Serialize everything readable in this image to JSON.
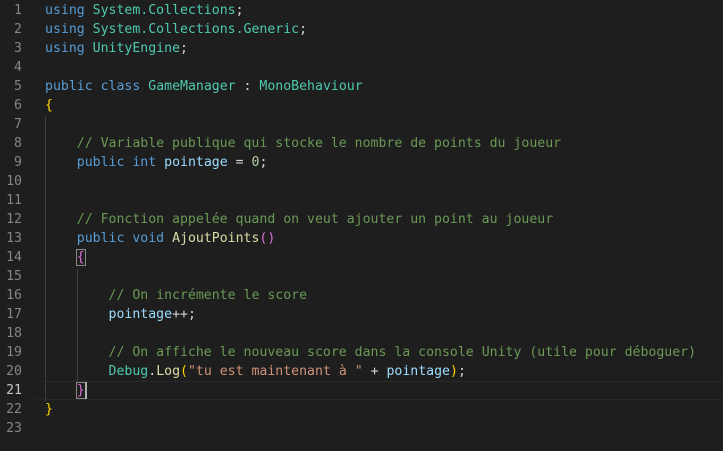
{
  "editor": {
    "lines": [
      {
        "n": "1",
        "tokens": [
          {
            "t": "using",
            "c": "kw"
          },
          {
            "t": " ",
            "c": "pun"
          },
          {
            "t": "System.Collections",
            "c": "ns"
          },
          {
            "t": ";",
            "c": "pun"
          }
        ]
      },
      {
        "n": "2",
        "tokens": [
          {
            "t": "using",
            "c": "kw"
          },
          {
            "t": " ",
            "c": "pun"
          },
          {
            "t": "System.Collections.Generic",
            "c": "ns"
          },
          {
            "t": ";",
            "c": "pun"
          }
        ]
      },
      {
        "n": "3",
        "tokens": [
          {
            "t": "using",
            "c": "kw"
          },
          {
            "t": " ",
            "c": "pun"
          },
          {
            "t": "UnityEngine",
            "c": "ns"
          },
          {
            "t": ";",
            "c": "pun"
          }
        ]
      },
      {
        "n": "4",
        "tokens": []
      },
      {
        "n": "5",
        "tokens": [
          {
            "t": "public",
            "c": "kw"
          },
          {
            "t": " ",
            "c": "pun"
          },
          {
            "t": "class",
            "c": "kw"
          },
          {
            "t": " ",
            "c": "pun"
          },
          {
            "t": "GameManager",
            "c": "cls"
          },
          {
            "t": " : ",
            "c": "pun"
          },
          {
            "t": "MonoBehaviour",
            "c": "cls"
          }
        ]
      },
      {
        "n": "6",
        "tokens": [
          {
            "t": "{",
            "c": "br1"
          }
        ]
      },
      {
        "n": "7",
        "tokens": []
      },
      {
        "n": "8",
        "tokens": [
          {
            "t": "    ",
            "c": "pun"
          },
          {
            "t": "// Variable publique qui stocke le nombre de points du joueur",
            "c": "cmt"
          }
        ]
      },
      {
        "n": "9",
        "tokens": [
          {
            "t": "    ",
            "c": "pun"
          },
          {
            "t": "public",
            "c": "kw"
          },
          {
            "t": " ",
            "c": "pun"
          },
          {
            "t": "int",
            "c": "kw"
          },
          {
            "t": " ",
            "c": "pun"
          },
          {
            "t": "pointage",
            "c": "var"
          },
          {
            "t": " = ",
            "c": "pun"
          },
          {
            "t": "0",
            "c": "num"
          },
          {
            "t": ";",
            "c": "pun"
          }
        ]
      },
      {
        "n": "10",
        "tokens": []
      },
      {
        "n": "11",
        "tokens": []
      },
      {
        "n": "12",
        "tokens": [
          {
            "t": "    ",
            "c": "pun"
          },
          {
            "t": "// Fonction appelée quand on veut ajouter un point au joueur",
            "c": "cmt"
          }
        ]
      },
      {
        "n": "13",
        "tokens": [
          {
            "t": "    ",
            "c": "pun"
          },
          {
            "t": "public",
            "c": "kw"
          },
          {
            "t": " ",
            "c": "pun"
          },
          {
            "t": "void",
            "c": "kw"
          },
          {
            "t": " ",
            "c": "pun"
          },
          {
            "t": "AjoutPoints",
            "c": "fn"
          },
          {
            "t": "()",
            "c": "br2"
          }
        ]
      },
      {
        "n": "14",
        "tokens": [
          {
            "t": "    ",
            "c": "pun"
          },
          {
            "t": "{",
            "c": "br2",
            "box": true
          }
        ]
      },
      {
        "n": "15",
        "tokens": []
      },
      {
        "n": "16",
        "tokens": [
          {
            "t": "        ",
            "c": "pun"
          },
          {
            "t": "// On incrémente le score",
            "c": "cmt"
          }
        ]
      },
      {
        "n": "17",
        "tokens": [
          {
            "t": "        ",
            "c": "pun"
          },
          {
            "t": "pointage",
            "c": "var"
          },
          {
            "t": "++;",
            "c": "pun"
          }
        ]
      },
      {
        "n": "18",
        "tokens": []
      },
      {
        "n": "19",
        "tokens": [
          {
            "t": "        ",
            "c": "pun"
          },
          {
            "t": "// On affiche le nouveau score dans la console Unity (utile pour déboguer)",
            "c": "cmt"
          }
        ]
      },
      {
        "n": "20",
        "tokens": [
          {
            "t": "        ",
            "c": "pun"
          },
          {
            "t": "Debug",
            "c": "cls"
          },
          {
            "t": ".",
            "c": "pun"
          },
          {
            "t": "Log",
            "c": "fn"
          },
          {
            "t": "(",
            "c": "br1"
          },
          {
            "t": "\"tu est maintenant à \"",
            "c": "str"
          },
          {
            "t": " + ",
            "c": "pun"
          },
          {
            "t": "pointage",
            "c": "var"
          },
          {
            "t": ")",
            "c": "br1"
          },
          {
            "t": ";",
            "c": "pun"
          }
        ]
      },
      {
        "n": "21",
        "tokens": [
          {
            "t": "    ",
            "c": "pun"
          },
          {
            "t": "}",
            "c": "br2",
            "box": true
          }
        ],
        "current": true
      },
      {
        "n": "22",
        "tokens": [
          {
            "t": "}",
            "c": "br1"
          }
        ]
      },
      {
        "n": "23",
        "tokens": []
      }
    ]
  }
}
